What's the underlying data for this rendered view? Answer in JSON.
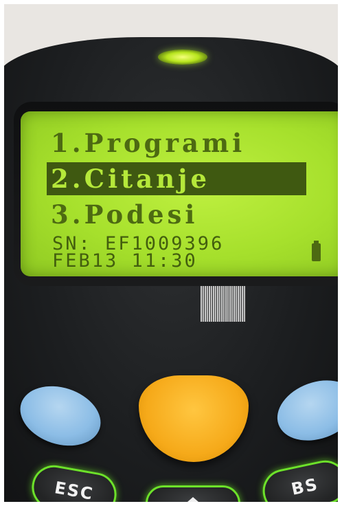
{
  "screen": {
    "menu_items": [
      "1.Programi",
      "2.Citanje",
      "3.Podesi"
    ],
    "selected_index": 1,
    "serial_line": "SN: EF1009396",
    "datetime_line": "FEB13 11:30"
  },
  "keys": {
    "esc_label": "ESC",
    "bs_label": "BS"
  },
  "icons": {
    "battery": "battery-icon",
    "up": "up-arrow-icon"
  },
  "colors": {
    "lcd_background": "#a6e02c",
    "lcd_text": "#4d6a12",
    "selection_bar": "#3f5911",
    "scan_key": "#f6aa1a",
    "side_keys": "#8cbde6",
    "key_glow": "#6de22a"
  }
}
